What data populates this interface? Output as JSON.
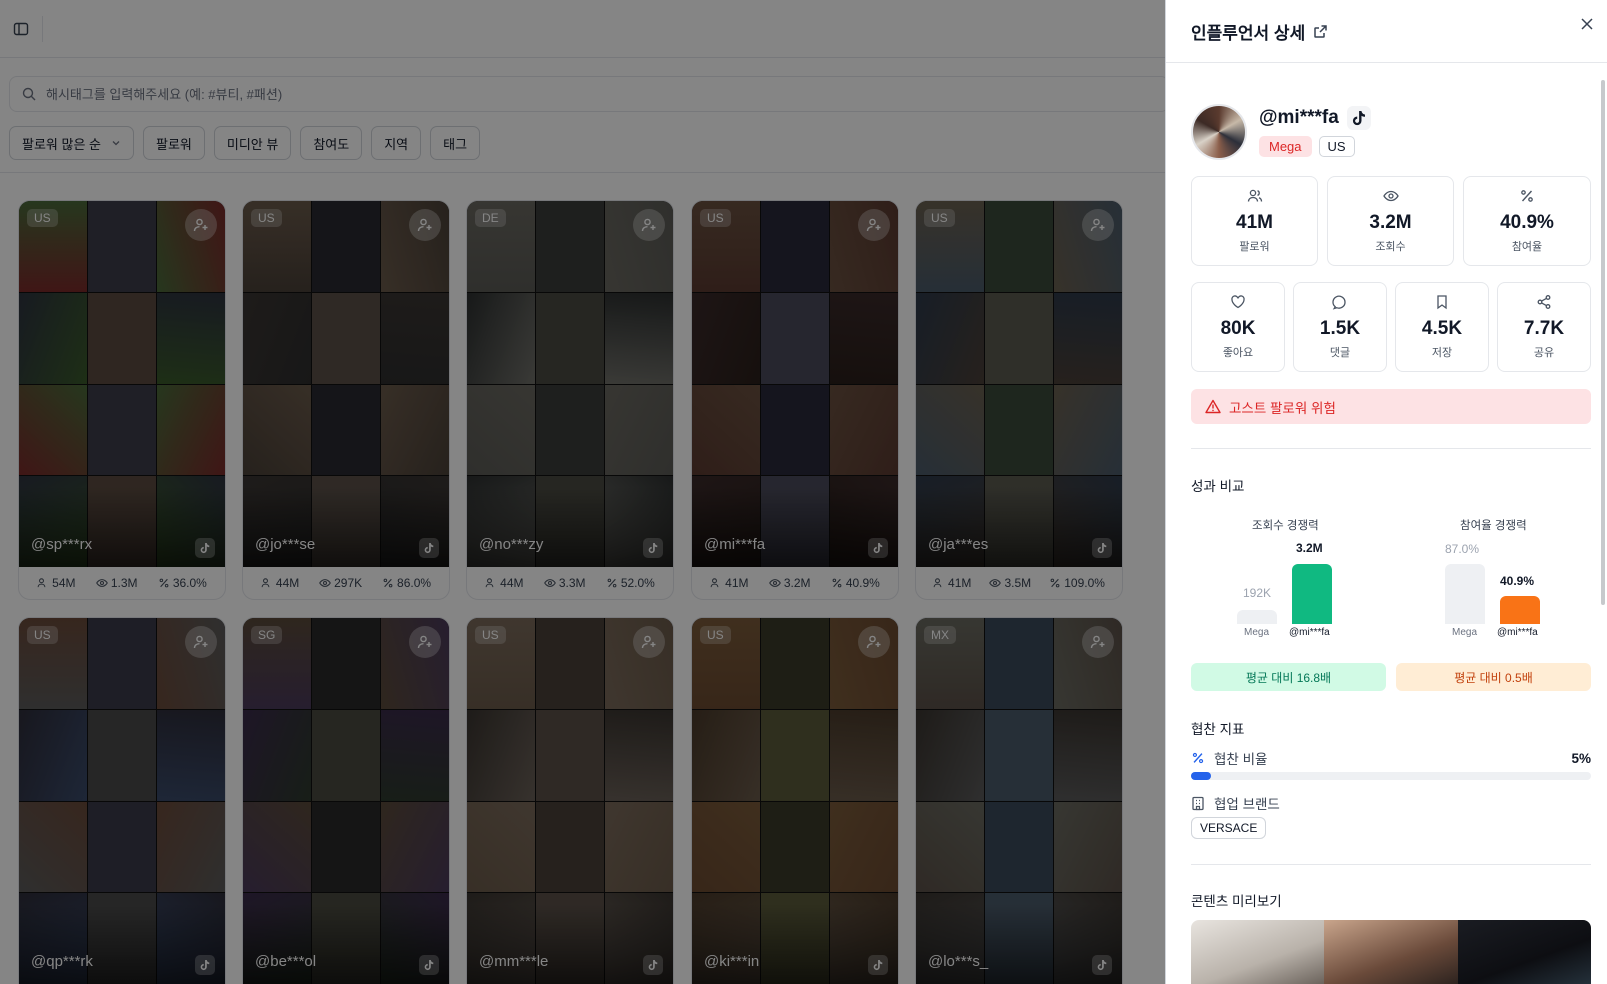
{
  "search": {
    "placeholder": "해시태그를 입력해주세요 (예: #뷰티, #패션)"
  },
  "filters": {
    "sort": "팔로워 많은 순",
    "items": [
      "팔로워",
      "미디안 뷰",
      "참여도",
      "지역",
      "태그"
    ]
  },
  "cards": [
    {
      "country": "US",
      "handle": "@sp***rx",
      "followers": "54M",
      "views": "1.3M",
      "engagement": "36.0%",
      "palette": [
        "#7a2a2a",
        "#3d3d4a",
        "#4a6a3a",
        "#2d3340",
        "#5a4a40",
        "#3a5a2a"
      ]
    },
    {
      "country": "US",
      "handle": "@jo***se",
      "followers": "44M",
      "views": "297K",
      "engagement": "86.0%",
      "palette": [
        "#4a4038",
        "#2a2a30",
        "#6a5a4a",
        "#3a3532",
        "#5a5048",
        "#2d2d2d"
      ]
    },
    {
      "country": "DE",
      "handle": "@no***zy",
      "followers": "44M",
      "views": "3.3M",
      "engagement": "52.0%",
      "palette": [
        "#5a5a55",
        "#3a3c3a",
        "#6a6860",
        "#2d3030",
        "#4a4a42",
        "#70706a"
      ]
    },
    {
      "country": "US",
      "handle": "@mi***fa",
      "followers": "41M",
      "views": "3.2M",
      "engagement": "40.9%",
      "palette": [
        "#5a3a30",
        "#2a2a3a",
        "#6a5040",
        "#3a2a2a",
        "#4a4a5a",
        "#2a1f1a"
      ]
    },
    {
      "country": "US",
      "handle": "@ja***es",
      "followers": "41M",
      "views": "3.5M",
      "engagement": "109.0%",
      "palette": [
        "#4a5a6a",
        "#3a4a3a",
        "#6a6050",
        "#2d3a4a",
        "#5a5a50",
        "#4a4038"
      ]
    },
    {
      "country": "US",
      "handle": "@qp***rk",
      "followers": "",
      "views": "",
      "engagement": "",
      "palette": [
        "#5a5a5a",
        "#3a3a4a",
        "#6a4a3a",
        "#2d2d3a",
        "#4a4a4a",
        "#3a4a6a"
      ]
    },
    {
      "country": "SG",
      "handle": "@be***ol",
      "followers": "",
      "views": "",
      "engagement": "",
      "palette": [
        "#4a3a5a",
        "#2a2a2a",
        "#5a4a3a",
        "#3a2a4a",
        "#4a4a40",
        "#2d3a2d"
      ]
    },
    {
      "country": "US",
      "handle": "@mm***le",
      "followers": "",
      "views": "",
      "engagement": "",
      "palette": [
        "#6a5a4a",
        "#4a4038",
        "#7a6a5a",
        "#3a3530",
        "#5a5048",
        "#6a6058"
      ]
    },
    {
      "country": "US",
      "handle": "@ki***in",
      "followers": "",
      "views": "",
      "engagement": "",
      "palette": [
        "#6a4a30",
        "#3a3a2a",
        "#7a5a3a",
        "#4a3a2a",
        "#5a5a3a",
        "#6a5a4a"
      ]
    },
    {
      "country": "MX",
      "handle": "@lo***s_",
      "followers": "",
      "views": "",
      "engagement": "",
      "palette": [
        "#5a5048",
        "#3a4a5a",
        "#6a6a60",
        "#3a3530",
        "#4a5a6a",
        "#5a5a5a"
      ]
    }
  ],
  "drawer": {
    "title": "인플루언서 상세",
    "handle": "@mi***fa",
    "tier": "Mega",
    "country": "US",
    "stats_top": [
      {
        "icon": "users-icon",
        "value": "41M",
        "label": "팔로워"
      },
      {
        "icon": "eye-icon",
        "value": "3.2M",
        "label": "조회수"
      },
      {
        "icon": "percent-icon",
        "value": "40.9%",
        "label": "참여율"
      }
    ],
    "stats_bottom": [
      {
        "icon": "heart-icon",
        "value": "80K",
        "label": "좋아요"
      },
      {
        "icon": "comment-icon",
        "value": "1.5K",
        "label": "댓글"
      },
      {
        "icon": "bookmark-icon",
        "value": "4.5K",
        "label": "저장"
      },
      {
        "icon": "share-icon",
        "value": "7.7K",
        "label": "공유"
      }
    ],
    "alert": "고스트 팔로워 위험",
    "performance_title": "성과 비교",
    "views_compare": {
      "title": "조회수 경쟁력",
      "avg_label": "192K",
      "avg_x": "Mega",
      "me_label": "3.2M",
      "me_x": "@mi***fa",
      "pill": "평균 대비 16.8배"
    },
    "engagement_compare": {
      "title": "참여율 경쟁력",
      "avg_label": "87.0%",
      "avg_x": "Mega",
      "me_label": "40.9%",
      "me_x": "@mi***fa",
      "pill": "평균 대비 0.5배"
    },
    "sponsor_title": "협찬 지표",
    "sponsor_ratio_label": "협찬 비율",
    "sponsor_ratio_value": "5%",
    "sponsor_ratio_fraction": 0.05,
    "brand_label": "협업 브랜드",
    "brand": "VERSACE",
    "preview_title": "콘텐츠 미리보기"
  },
  "chart_data": [
    {
      "type": "bar",
      "title": "조회수 경쟁력",
      "categories": [
        "Mega",
        "@mi***fa"
      ],
      "values": [
        192000,
        3200000
      ]
    },
    {
      "type": "bar",
      "title": "참여율 경쟁력",
      "categories": [
        "Mega",
        "@mi***fa"
      ],
      "values": [
        87.0,
        40.9
      ]
    }
  ],
  "colors": {
    "accent_blue": "#2563eb",
    "green": "#10b981",
    "orange": "#f97316",
    "danger": "#dc2626"
  }
}
